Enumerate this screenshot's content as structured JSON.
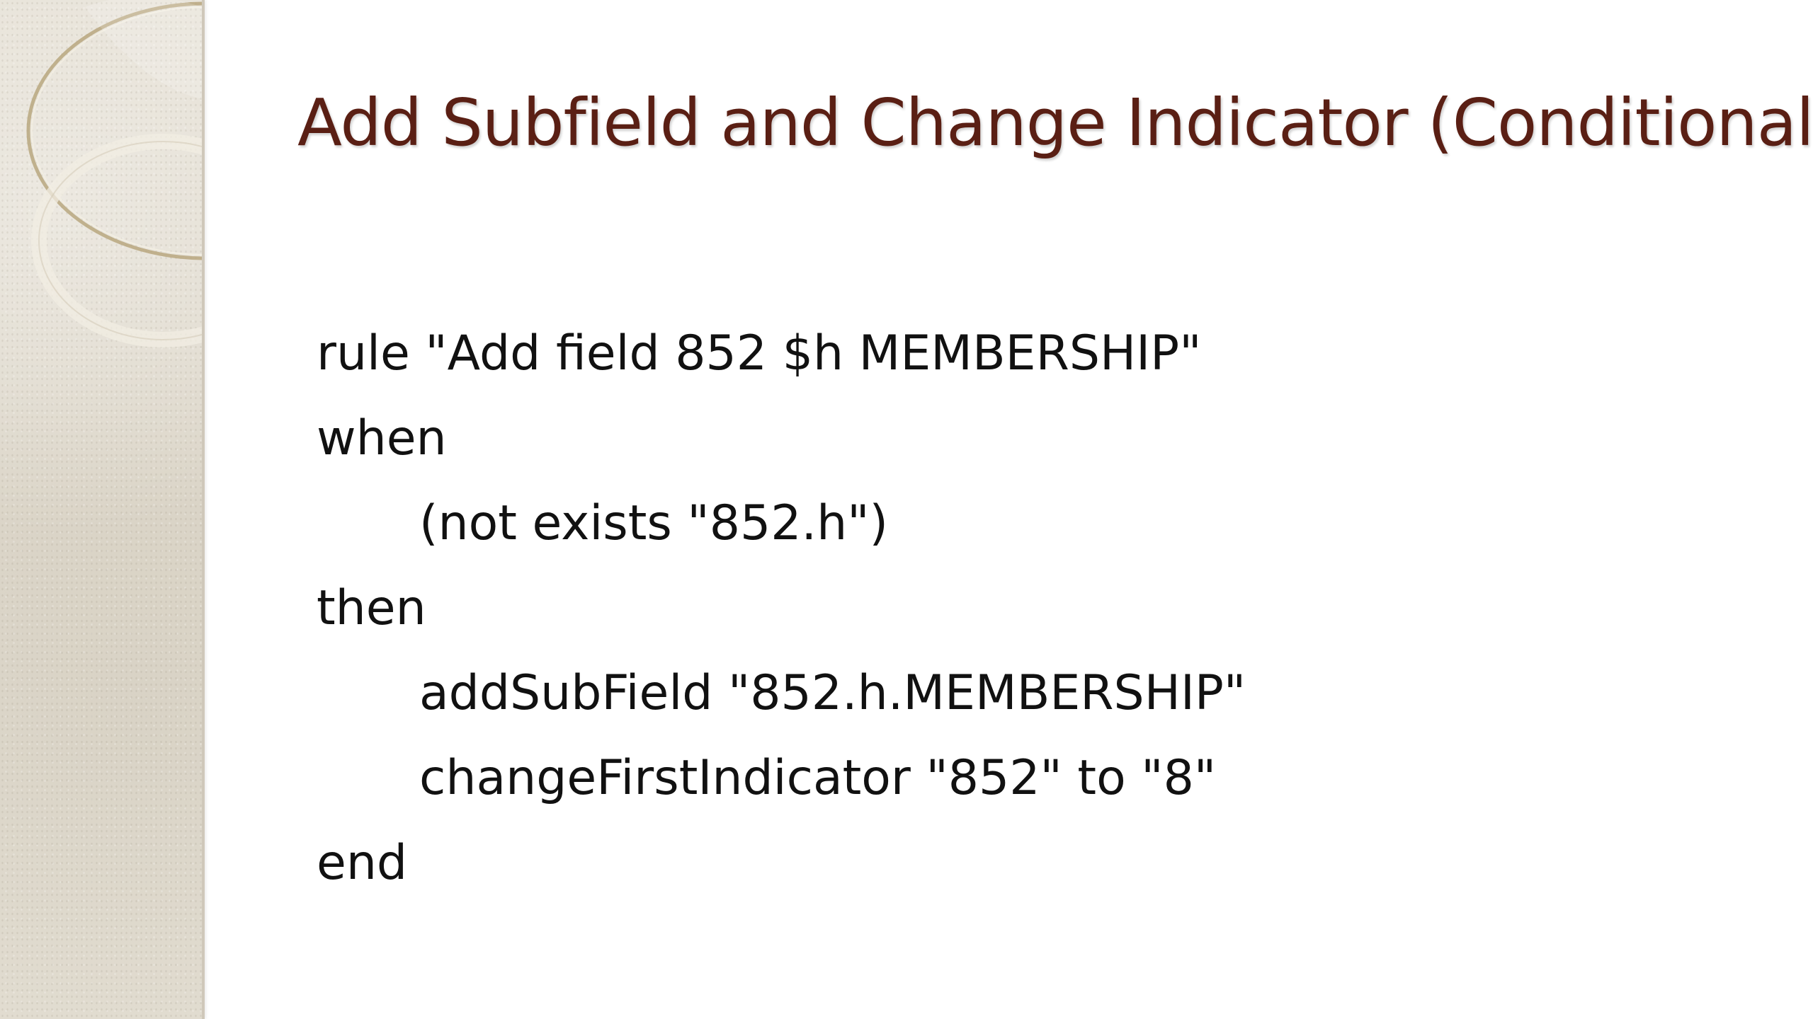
{
  "slide": {
    "title": "Add Subfield and Change Indicator (Conditional)",
    "code_lines": [
      "rule \"Add field 852 $h MEMBERSHIP\"",
      "when",
      "(not exists \"852.h\")",
      "then",
      "addSubField \"852.h.MEMBERSHIP\"",
      "changeFirstIndicator \"852\" to \"8\"",
      "end"
    ]
  },
  "colors": {
    "title": "#5a1f14",
    "body_text": "#111111",
    "sidebar": "#e2ddd1",
    "background": "#ffffff"
  }
}
